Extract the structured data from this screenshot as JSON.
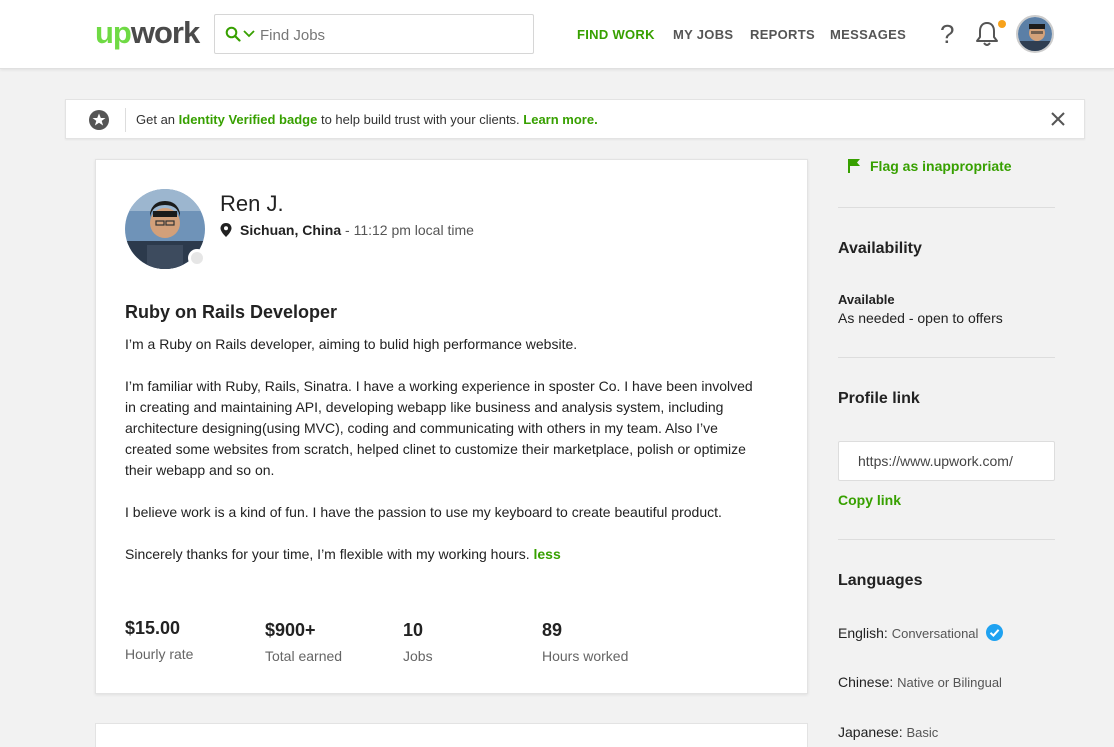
{
  "header": {
    "logo_up": "up",
    "logo_work": "work",
    "search_placeholder": "Find Jobs",
    "nav": [
      "FIND WORK",
      "MY JOBS",
      "REPORTS",
      "MESSAGES"
    ],
    "help_label": "?",
    "accent_color": "#37a000"
  },
  "banner": {
    "prefix": "Get an ",
    "badge_link": "Identity Verified badge",
    "middle": " to help build trust with your clients. ",
    "learn_more": "Learn more."
  },
  "profile": {
    "name": "Ren J.",
    "location": "Sichuan, China",
    "local_time": " - 11:12 pm local time",
    "title": "Ruby on Rails Developer",
    "paragraphs": [
      "I’m a Ruby on Rails developer, aiming to bulid high performance website.",
      "I’m familiar with Ruby, Rails, Sinatra. I have a working experience in sposter Co. I have been involved in creating and maintaining API, developing webapp like business and analysis system, including architecture designing(using MVC), coding and communicating with others in my team. Also I’ve created some websites from scratch, helped clinet to customize their marketplace, polish or optimize their webapp and so on.",
      "I believe work is a kind of fun. I have the passion to use my keyboard to create beautiful product.",
      "Sincerely thanks for your time, I’m flexible with my working hours. "
    ],
    "less_link": "less",
    "stats": [
      {
        "value": "$15.00",
        "label": "Hourly rate"
      },
      {
        "value": "$900+",
        "label": "Total earned"
      },
      {
        "value": "10",
        "label": "Jobs"
      },
      {
        "value": "89",
        "label": "Hours worked"
      }
    ]
  },
  "sidebar": {
    "flag": "Flag as inappropriate",
    "availability_heading": "Availability",
    "availability_status": "Available",
    "availability_detail": "As needed - open to offers",
    "profile_link_heading": "Profile link",
    "profile_link_value": "https://www.upwork.com/",
    "copy_link": "Copy link",
    "languages_heading": "Languages",
    "languages": [
      {
        "name": "English:",
        "level": "Conversational",
        "verified": true
      },
      {
        "name": "Chinese:",
        "level": "Native or Bilingual",
        "verified": false
      },
      {
        "name": "Japanese:",
        "level": "Basic",
        "verified": false
      }
    ]
  }
}
